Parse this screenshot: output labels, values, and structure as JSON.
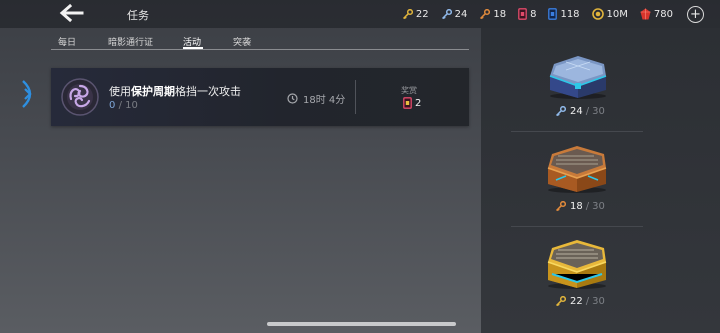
{
  "header": {
    "title": "任务",
    "back_icon": "back-arrow-icon"
  },
  "resources": [
    {
      "icon": "gold-key-icon",
      "value": "22",
      "color": "#e0b43c"
    },
    {
      "icon": "blue-key-icon",
      "value": "24",
      "color": "#8fb8e8"
    },
    {
      "icon": "orange-key-icon",
      "value": "18",
      "color": "#e08a3c"
    },
    {
      "icon": "red-card-icon",
      "value": "8",
      "color": "#e04a6a"
    },
    {
      "icon": "blue-card-icon",
      "value": "118",
      "color": "#3a7ee0"
    },
    {
      "icon": "coin-icon",
      "value": "10M",
      "color": "#e0b43c"
    },
    {
      "icon": "red-gem-icon",
      "value": "780",
      "color": "#d8342c"
    }
  ],
  "tabs": [
    {
      "label": "每日",
      "active": false
    },
    {
      "label": "暗影通行证",
      "active": false
    },
    {
      "label": "活动",
      "active": true
    },
    {
      "label": "突袭",
      "active": false
    }
  ],
  "quest": {
    "text_prefix": "使用",
    "text_bold": "保护周期",
    "text_suffix": "格挡一次攻击",
    "progress_current": "0",
    "progress_separator": "/",
    "progress_max": "10",
    "timer": "18时 4分",
    "reward_label": "奖赏",
    "reward_value": "2",
    "reward_icon": "red-card-icon"
  },
  "chests": [
    {
      "name": "blue-chest",
      "key_icon": "blue-key-icon",
      "current": "24",
      "separator": "/",
      "max": "30",
      "key_color": "#8fb8e8"
    },
    {
      "name": "bronze-chest",
      "key_icon": "orange-key-icon",
      "current": "18",
      "separator": "/",
      "max": "30",
      "key_color": "#e08a3c"
    },
    {
      "name": "gold-chest",
      "key_icon": "gold-key-icon",
      "current": "22",
      "separator": "/",
      "max": "30",
      "key_color": "#e0b43c"
    }
  ]
}
